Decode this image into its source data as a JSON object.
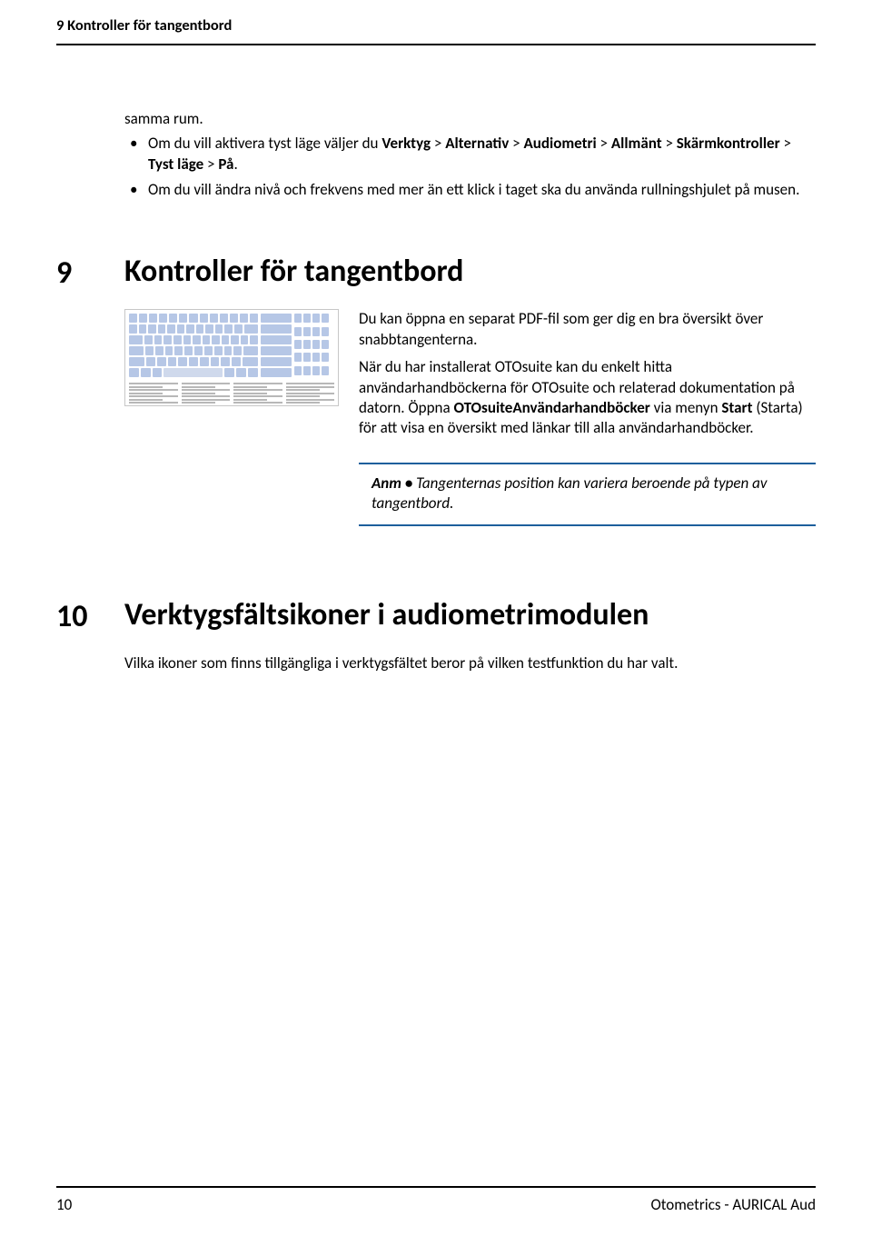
{
  "header": {
    "running_title": "9 Kontroller för tangentbord"
  },
  "intro": {
    "lead": "samma rum.",
    "bullets": [
      {
        "pre": "Om du vill aktivera tyst läge väljer du ",
        "path": [
          "Verktyg",
          "Alternativ",
          "Audiometri",
          "Allmänt",
          "Skärmkontroller",
          "Tyst läge",
          "På"
        ],
        "sep": " > ",
        "post": "."
      },
      {
        "plain": "Om du vill ändra nivå och frekvens med mer än ett klick i taget ska du använda rullningshjulet på musen."
      }
    ]
  },
  "section9": {
    "number": "9",
    "title": "Kontroller för tangentbord",
    "p1": "Du kan öppna en separat PDF-fil som ger dig en bra översikt över snabbtangenterna.",
    "p2_a": "När du har installerat OTOsuite kan du enkelt hitta användarhandböckerna för OTOsuite och relaterad dokumentation på datorn. Öppna ",
    "p2_b_bold": "OTOsuiteAnvändarhandböcker",
    "p2_c": " via menyn ",
    "p2_d_bold": "Start",
    "p2_e": " (Starta) för att visa en översikt med länkar till alla användarhandböcker.",
    "note_label": "Anm • ",
    "note_text": "Tangenternas position kan variera beroende på typen av tangentbord."
  },
  "section10": {
    "number": "10",
    "title": "Verktygsfältsikoner i audiometrimodulen",
    "p1": "Vilka ikoner som finns tillgängliga i verktygsfältet beror på vilken testfunktion du har valt."
  },
  "footer": {
    "page_number": "10",
    "product": "Otometrics - AURICAL Aud"
  }
}
